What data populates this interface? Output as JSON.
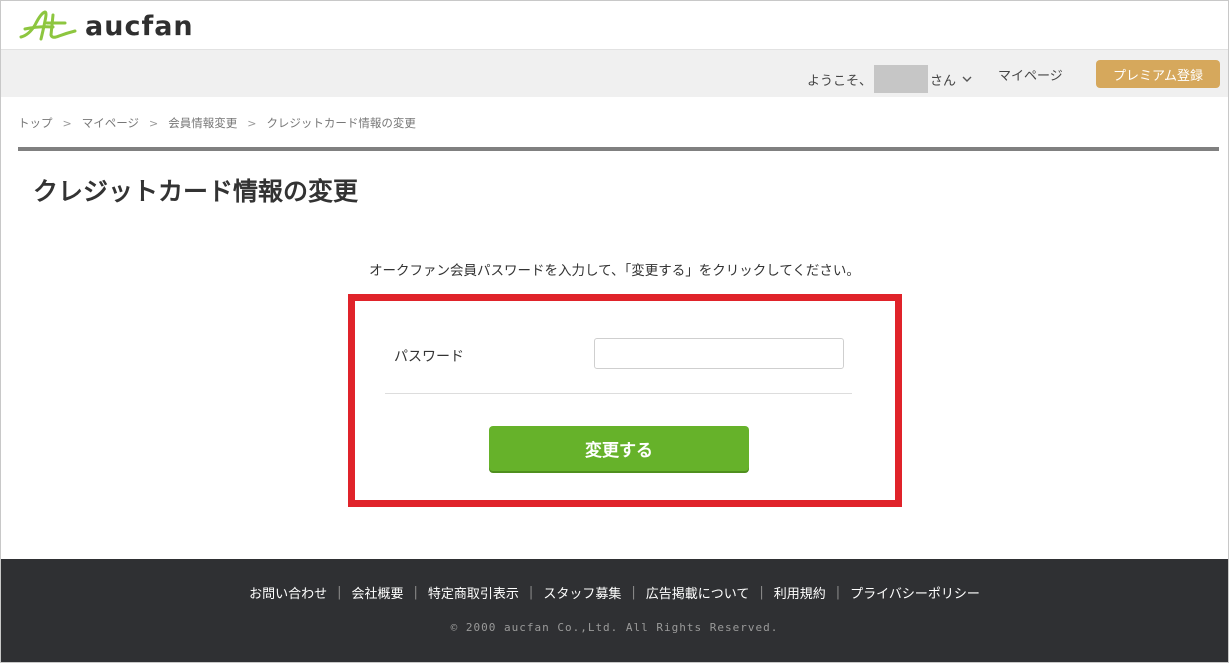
{
  "header": {
    "logo_text": "aucfan",
    "logo_color": "#8dc63f"
  },
  "navbar": {
    "welcome_prefix": "ようこそ、",
    "welcome_suffix": "さん",
    "mypage_label": "マイページ",
    "premium_label": "プレミアム登録",
    "premium_color": "#d6a85c"
  },
  "breadcrumb": {
    "items": [
      "トップ",
      "マイページ",
      "会員情報変更",
      "クレジットカード情報の変更"
    ],
    "separator": ">"
  },
  "page": {
    "title": "クレジットカード情報の変更",
    "instruction": "オークファン会員パスワードを入力して、「変更する」をクリックしてください。"
  },
  "form": {
    "password_label": "パスワード",
    "password_value": "",
    "password_placeholder": "",
    "submit_label": "変更する",
    "submit_color": "#66b22a",
    "highlight_color": "#e0232a"
  },
  "footer": {
    "links": [
      "お問い合わせ",
      "会社概要",
      "特定商取引表示",
      "スタッフ募集",
      "広告掲載について",
      "利用規約",
      "プライバシーポリシー"
    ],
    "copyright": "© 2000 aucfan Co.,Ltd. All Rights Reserved."
  }
}
